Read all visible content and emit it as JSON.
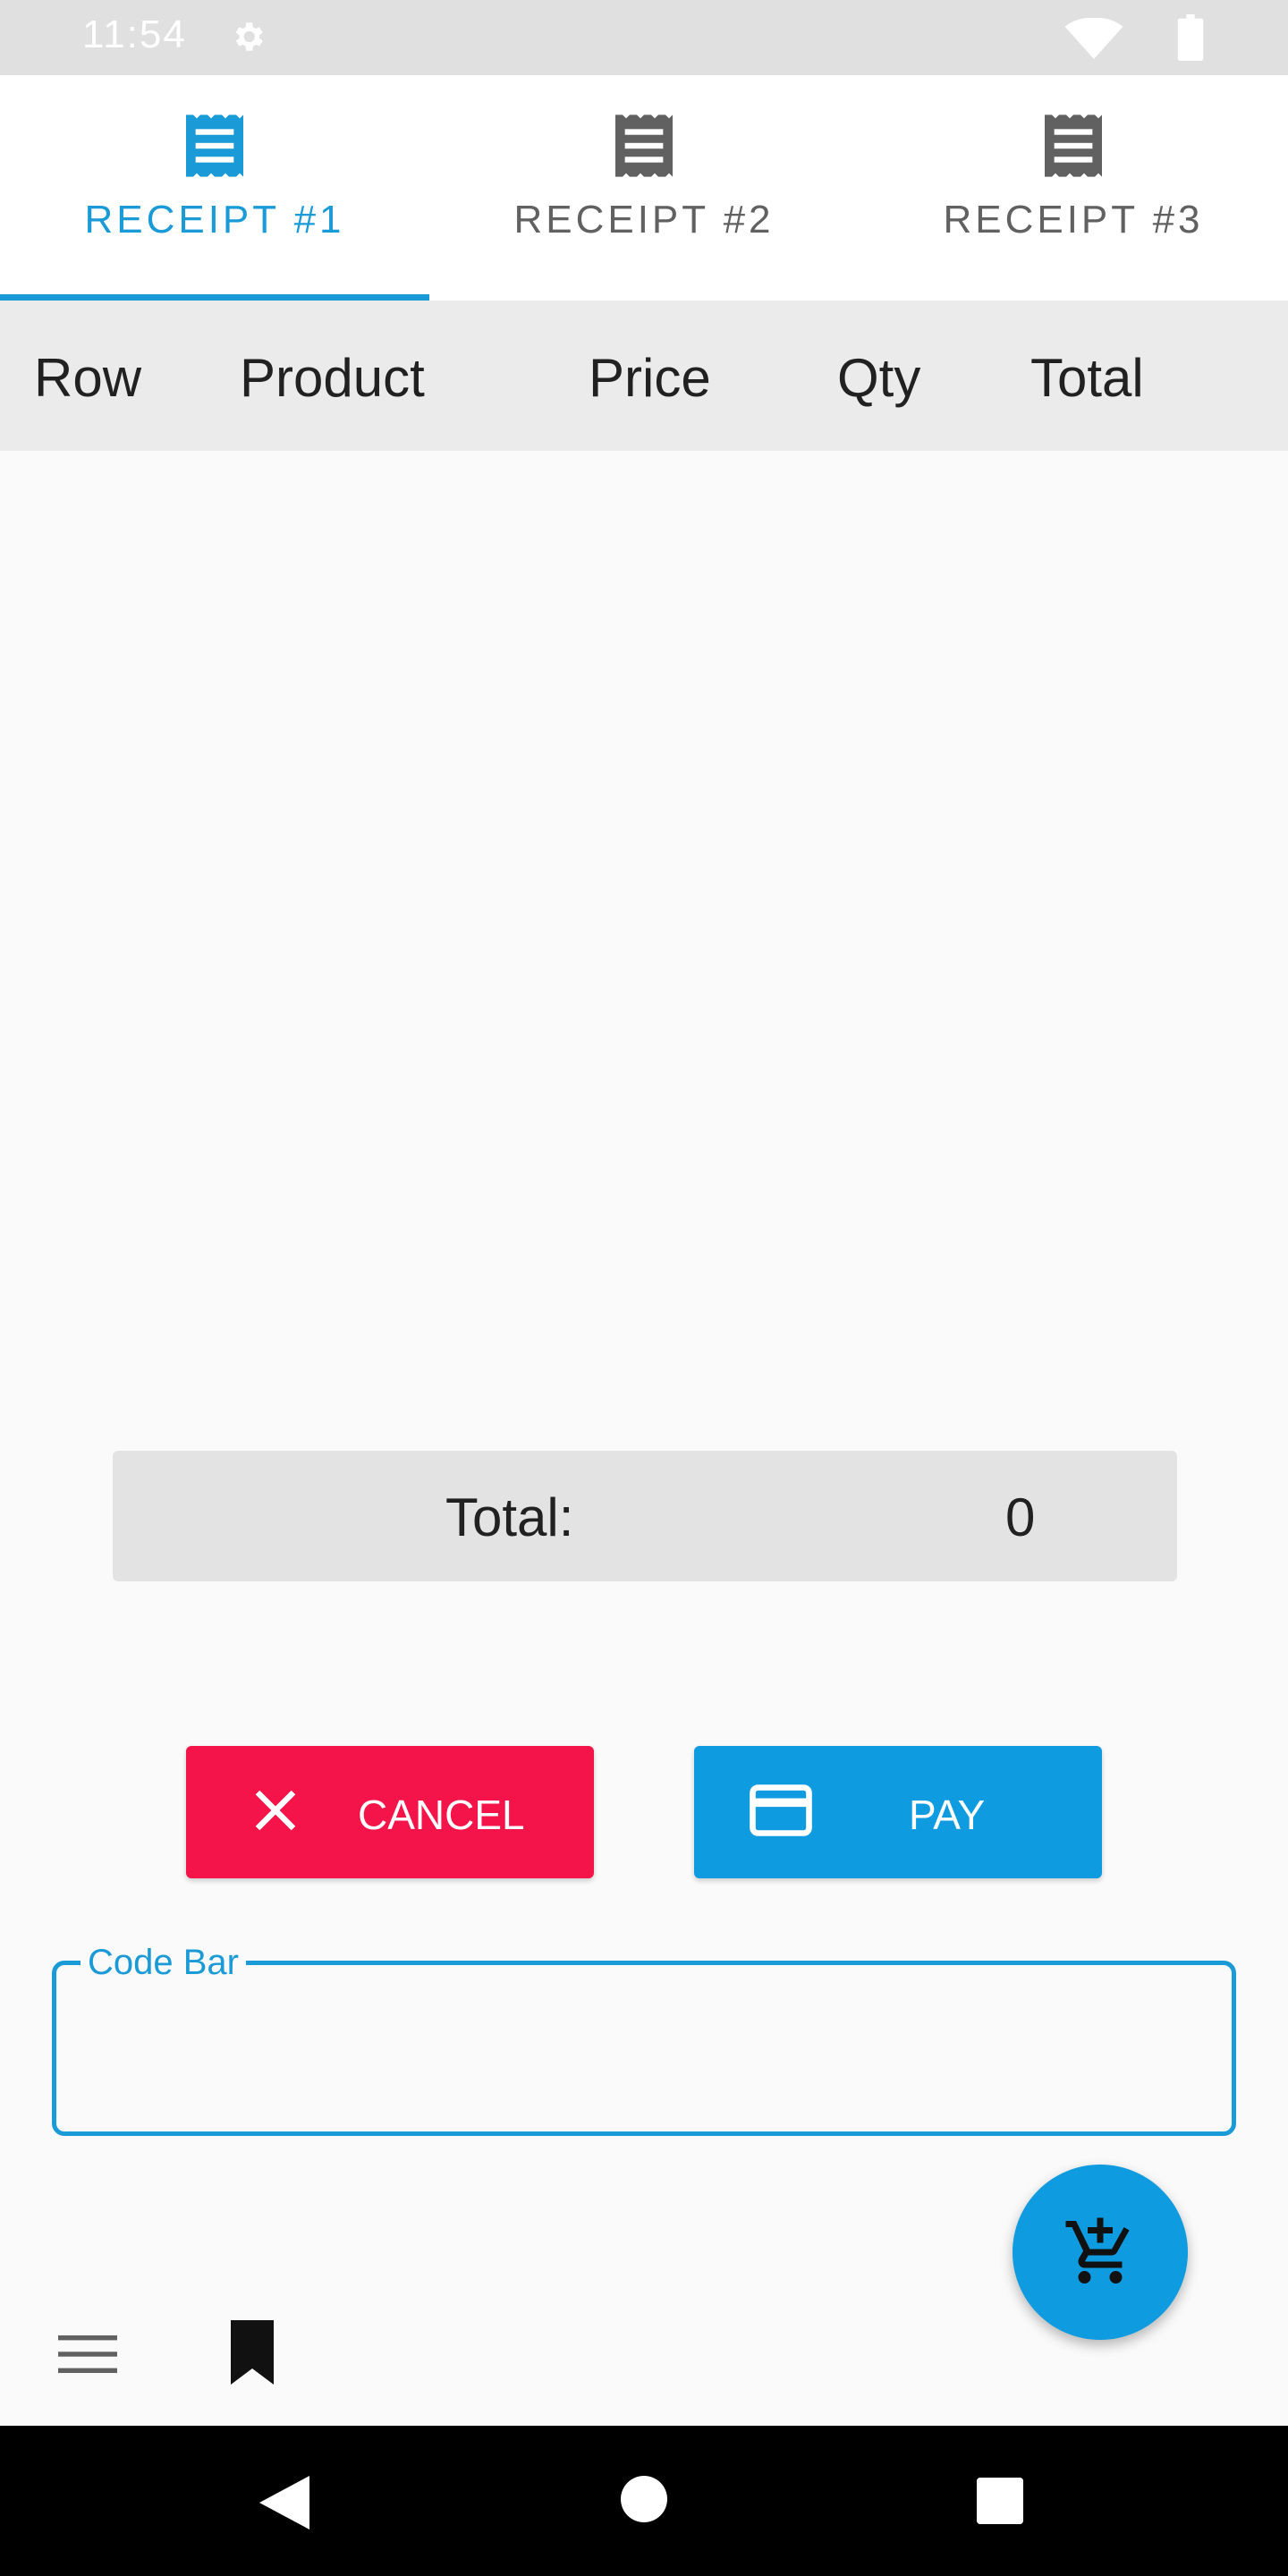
{
  "status_bar": {
    "time": "11:54",
    "icons": [
      "gear-icon",
      "wifi-icon",
      "battery-icon"
    ]
  },
  "tabs": [
    {
      "label": "RECEIPT #1",
      "icon": "receipt-icon",
      "active": true
    },
    {
      "label": "RECEIPT #2",
      "icon": "receipt-icon",
      "active": false
    },
    {
      "label": "RECEIPT #3",
      "icon": "receipt-icon",
      "active": false
    }
  ],
  "table": {
    "columns": [
      "Row",
      "Product",
      "Price",
      "Qty",
      "Total"
    ],
    "rows": []
  },
  "total": {
    "label": "Total:",
    "value": "0"
  },
  "actions": {
    "cancel_label": "CANCEL",
    "cancel_icon": "close-icon",
    "pay_label": "PAY",
    "pay_icon": "credit-card-icon"
  },
  "codebar": {
    "label": "Code Bar",
    "value": ""
  },
  "fab": {
    "icon": "add-to-cart-icon"
  },
  "bottom_bar": {
    "icons": [
      "menu-icon",
      "bookmark-icon"
    ]
  },
  "nav_bar": {
    "icons": [
      "back-icon",
      "home-icon",
      "recents-icon"
    ]
  },
  "colors": {
    "accent": "#1a9ad6",
    "cancel": "#f5144a",
    "pay": "#0f9be0",
    "table_header_bg": "#ebebeb",
    "total_bg": "#e3e3e3"
  }
}
